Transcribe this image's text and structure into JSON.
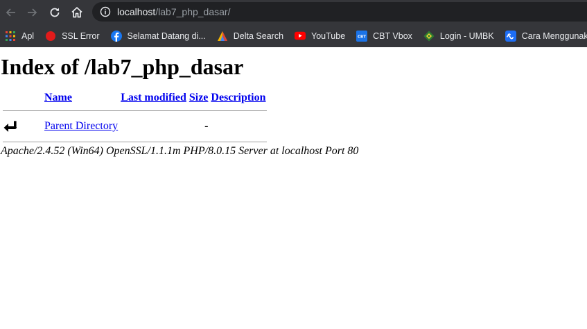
{
  "browser": {
    "url_host": "localhost",
    "url_path": "/lab7_php_dasar/"
  },
  "bookmarks": [
    {
      "label": "Apl",
      "icon": "apps-grid-icon"
    },
    {
      "label": "SSL Error",
      "icon": "red-dot-icon"
    },
    {
      "label": "Selamat Datang di...",
      "icon": "facebook-icon"
    },
    {
      "label": "Delta Search",
      "icon": "delta-icon"
    },
    {
      "label": "YouTube",
      "icon": "youtube-icon"
    },
    {
      "label": "CBT Vbox",
      "icon": "cbt-icon"
    },
    {
      "label": "Login - UMBK",
      "icon": "umbk-icon"
    },
    {
      "label": "Cara Menggunakan...",
      "icon": "wave-icon"
    }
  ],
  "page": {
    "title": "Index of /lab7_php_dasar",
    "columns": {
      "name": "Name",
      "last_modified": "Last modified",
      "size": "Size",
      "description": "Description"
    },
    "rows": [
      {
        "name": "Parent Directory",
        "last_modified": "",
        "size": "-",
        "description": ""
      }
    ],
    "address": "Apache/2.4.52 (Win64) OpenSSL/1.1.1m PHP/8.0.15 Server at localhost Port 80"
  },
  "colors": {
    "chrome_bg": "#35363a",
    "omnibox_bg": "#202124",
    "link": "#0000ee"
  }
}
